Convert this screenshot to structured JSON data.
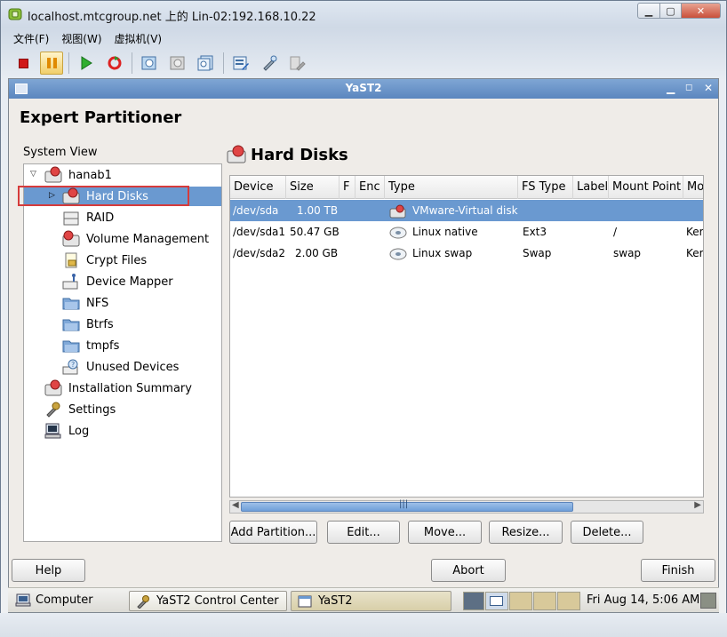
{
  "outer_window": {
    "title": "localhost.mtcgroup.net 上的 Lin-02:192.168.10.22",
    "menu": [
      "文件(F)",
      "视图(W)",
      "虚拟机(V)"
    ],
    "toolbar_icons": [
      "stop-icon",
      "pause-icon",
      "play-icon",
      "restart-icon",
      "snapshot-icon",
      "revert-snapshot-icon",
      "manage-snapshots-icon",
      "vm-settings-icon",
      "edit-settings-icon",
      "disabled-settings-icon"
    ]
  },
  "yast_window": {
    "title": "YaST2",
    "page_title": "Expert Partitioner",
    "system_view_label": "System View",
    "tree": {
      "root": "hanab1",
      "children": [
        "Hard Disks",
        "RAID",
        "Volume Management",
        "Crypt Files",
        "Device Mapper",
        "NFS",
        "Btrfs",
        "tmpfs",
        "Unused Devices"
      ],
      "top_level": [
        "Installation Summary",
        "Settings",
        "Log"
      ]
    },
    "panel_title": "Hard Disks",
    "columns": [
      "Device",
      "Size",
      "F",
      "Enc",
      "Type",
      "FS Type",
      "Label",
      "Mount Point",
      "Mo"
    ],
    "rows": [
      {
        "device": "/dev/sda",
        "size": "1.00 TB",
        "f": "",
        "enc": "",
        "type": "VMware-Virtual disk",
        "fs_type": "",
        "label": "",
        "mount_point": "",
        "mo": ""
      },
      {
        "device": "/dev/sda1",
        "size": "50.47 GB",
        "f": "",
        "enc": "",
        "type": "Linux native",
        "fs_type": "Ext3",
        "label": "",
        "mount_point": "/",
        "mo": "Ker"
      },
      {
        "device": "/dev/sda2",
        "size": "2.00 GB",
        "f": "",
        "enc": "",
        "type": "Linux swap",
        "fs_type": "Swap",
        "label": "",
        "mount_point": "swap",
        "mo": "Ker"
      }
    ],
    "action_buttons": [
      "Add Partition...",
      "Edit...",
      "Move...",
      "Resize...",
      "Delete..."
    ],
    "bottom_buttons": {
      "help": "Help",
      "abort": "Abort",
      "finish": "Finish"
    }
  },
  "taskbar": {
    "computer": "Computer",
    "tasks": [
      "YaST2 Control Center",
      "YaST2"
    ],
    "clock": "Fri Aug 14,  5:06 AM"
  }
}
